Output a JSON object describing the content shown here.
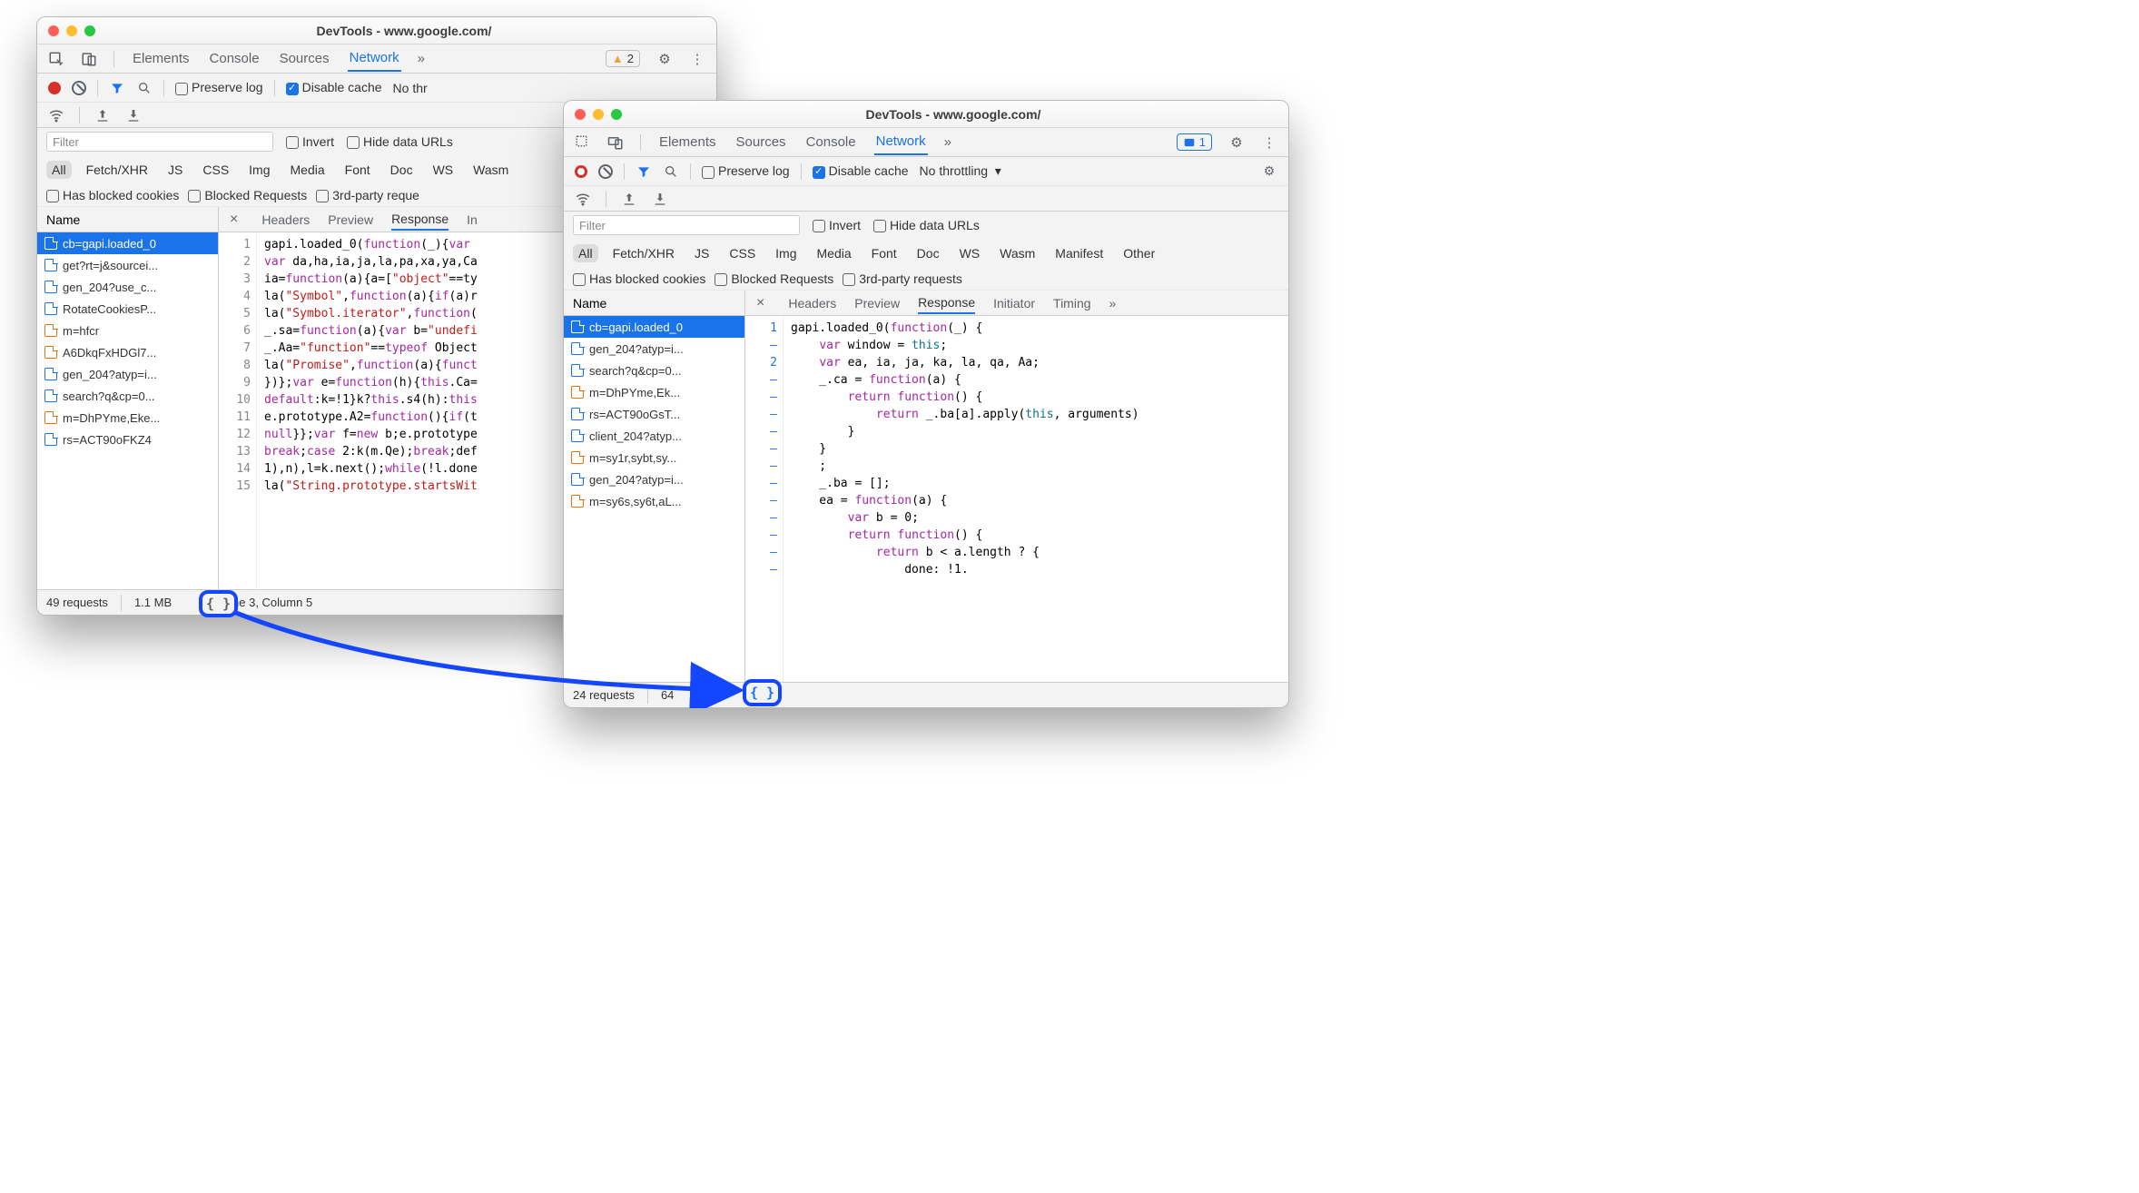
{
  "window1": {
    "title": "DevTools - www.google.com/",
    "tabs": [
      "Elements",
      "Console",
      "Sources",
      "Network"
    ],
    "active_tab": "Network",
    "more_tabs_icon": "»",
    "issues_count": "2",
    "preserve_log": "Preserve log",
    "disable_cache": "Disable cache",
    "throttling_truncated": "No thr",
    "filter_placeholder": "Filter",
    "invert": "Invert",
    "hide_data_urls": "Hide data URLs",
    "type_filters": [
      "All",
      "Fetch/XHR",
      "JS",
      "CSS",
      "Img",
      "Media",
      "Font",
      "Doc",
      "WS",
      "Wasm"
    ],
    "has_blocked_cookies": "Has blocked cookies",
    "blocked_requests": "Blocked Requests",
    "third_party_truncated": "3rd-party reque",
    "name_header": "Name",
    "requests": [
      {
        "name": "cb=gapi.loaded_0",
        "type": "js",
        "selected": true
      },
      {
        "name": "get?rt=j&sourcei...",
        "type": "doc"
      },
      {
        "name": "gen_204?use_c...",
        "type": "doc"
      },
      {
        "name": "RotateCookiesP...",
        "type": "txt"
      },
      {
        "name": "m=hfcr",
        "type": "js"
      },
      {
        "name": "A6DkqFxHDGl7...",
        "type": "js"
      },
      {
        "name": "gen_204?atyp=i...",
        "type": "doc"
      },
      {
        "name": "search?q&cp=0...",
        "type": "doc"
      },
      {
        "name": "m=DhPYme,Eke...",
        "type": "js"
      },
      {
        "name": "rs=ACT90oFKZ4",
        "type": "doc"
      }
    ],
    "detail_tabs": [
      "Headers",
      "Preview",
      "Response",
      "In"
    ],
    "detail_active": "Response",
    "gutter": " 1\n 2\n 3\n 4\n 5\n 6\n 7\n 8\n 9\n10\n11\n12\n13\n14\n15",
    "code_lines": [
      {
        "t": "gapi.loaded_0(",
        "kw": "function",
        "t2": "(_){",
        "kw2": "var",
        "t3": " "
      },
      {
        "kw": "var",
        "t": " da,ha,ia,ja,la,pa,xa,ya,Ca"
      },
      {
        "t": "ia=",
        "kw": "function",
        "t2": "(a){a=[",
        "str": "\"object\"",
        "t3": "==ty"
      },
      {
        "t": "la(",
        "str": "\"Symbol\"",
        "t2": ",",
        "kw": "function",
        "t3": "(a){",
        "kw2": "if",
        "t4": "(a)r"
      },
      {
        "t": "la(",
        "str": "\"Symbol.iterator\"",
        "t2": ",",
        "kw": "function",
        "t3": "("
      },
      {
        "t": "_.sa=",
        "kw": "function",
        "t2": "(a){",
        "kw2": "var",
        "t3": " b=",
        "str": "\"undefi"
      },
      {
        "t": "_.Aa=",
        "str": "\"function\"",
        "t2": "==",
        "kw": "typeof",
        "t3": " Object"
      },
      {
        "t": "la(",
        "str": "\"Promise\"",
        "t2": ",",
        "kw": "function",
        "t3": "(a){",
        "kw2": "funct"
      },
      {
        "t": "})};",
        "kw": "var",
        "t2": " e=",
        "kw2": "function",
        "t3": "(h){",
        "kw3": "this",
        "t4": ".Ca="
      },
      {
        "kw": "default",
        "t": ":k=!1}k?",
        "kw2": "this",
        "t2": ".s4(h):",
        "kw3": "this"
      },
      {
        "t": "e.prototype.A2=",
        "kw": "function",
        "t2": "(){",
        "kw2": "if",
        "t3": "(t"
      },
      {
        "kw": "null",
        "t": "}};",
        "kw2": "var",
        "t2": " f=",
        "kw3": "new",
        "t3": " b;e.prototype"
      },
      {
        "kw": "break",
        "t": ";",
        "kw2": "case",
        "t2": " 2:k(m.Qe);",
        "kw3": "break",
        "t3": ";def"
      },
      {
        "t": "1),n),l=k.next();",
        "kw": "while",
        "t2": "(!l.done"
      },
      {
        "t": "la(",
        "str": "\"String.prototype.startsWit"
      }
    ],
    "status_requests": "49 requests",
    "status_size": "1.1 MB",
    "status_cursor": "ine 3, Column 5",
    "pretty_print": "{ }"
  },
  "window2": {
    "title": "DevTools - www.google.com/",
    "tabs": [
      "Elements",
      "Sources",
      "Console",
      "Network"
    ],
    "active_tab": "Network",
    "more_tabs_icon": "»",
    "issues_count": "1",
    "preserve_log": "Preserve log",
    "disable_cache": "Disable cache",
    "throttling": "No throttling",
    "filter_placeholder": "Filter",
    "invert": "Invert",
    "hide_data_urls": "Hide data URLs",
    "type_filters": [
      "All",
      "Fetch/XHR",
      "JS",
      "CSS",
      "Img",
      "Media",
      "Font",
      "Doc",
      "WS",
      "Wasm",
      "Manifest",
      "Other"
    ],
    "has_blocked_cookies": "Has blocked cookies",
    "blocked_requests": "Blocked Requests",
    "third_party": "3rd-party requests",
    "name_header": "Name",
    "requests": [
      {
        "name": "cb=gapi.loaded_0",
        "type": "js",
        "selected": true
      },
      {
        "name": "gen_204?atyp=i...",
        "type": "doc"
      },
      {
        "name": "search?q&cp=0...",
        "type": "doc"
      },
      {
        "name": "m=DhPYme,Ek...",
        "type": "js"
      },
      {
        "name": "rs=ACT90oGsT...",
        "type": "doc"
      },
      {
        "name": "client_204?atyp...",
        "type": "doc"
      },
      {
        "name": "m=sy1r,sybt,sy...",
        "type": "js"
      },
      {
        "name": "gen_204?atyp=i...",
        "type": "doc"
      },
      {
        "name": "m=sy6s,sy6t,aL...",
        "type": "js"
      }
    ],
    "detail_tabs": [
      "Headers",
      "Preview",
      "Response",
      "Initiator",
      "Timing",
      "»"
    ],
    "detail_active": "Response",
    "gutter": "1\n–\n2\n–\n–\n–\n–\n–\n–\n–\n–\n–\n–\n–\n–",
    "code_lines": [
      {
        "t": "gapi.loaded_0(",
        "kw": "function",
        "t2": "(_) {"
      },
      {
        "pad": "    ",
        "kw": "var",
        "t": " window = ",
        "th": "this",
        "t2": ";"
      },
      {
        "pad": "    ",
        "kw": "var",
        "t": " ea, ia, ja, ka, la, qa, Aa;"
      },
      {
        "pad": "    ",
        "t": "_.ca = ",
        "kw": "function",
        "t2": "(a) {"
      },
      {
        "pad": "        ",
        "kw": "return",
        "t": " ",
        "kw2": "function",
        "t2": "() {"
      },
      {
        "pad": "            ",
        "kw": "return",
        "t": " _.ba[a].apply(",
        "th": "this",
        "t2": ", arguments)"
      },
      {
        "pad": "        ",
        "t": "}"
      },
      {
        "pad": "    ",
        "t": "}"
      },
      {
        "pad": "    ",
        "t": ";"
      },
      {
        "pad": "    ",
        "t": "_.ba = [];"
      },
      {
        "pad": "    ",
        "t": "ea = ",
        "kw": "function",
        "t2": "(a) {"
      },
      {
        "pad": "        ",
        "kw": "var",
        "t": " b = 0;"
      },
      {
        "pad": "        ",
        "kw": "return",
        "t": " ",
        "kw2": "function",
        "t2": "() {"
      },
      {
        "pad": "            ",
        "kw": "return",
        "t": " b < a.length ? {"
      },
      {
        "pad": "                ",
        "t": "done: !1."
      }
    ],
    "status_requests": "24 requests",
    "status_size": "64",
    "pretty_print": "{ }"
  }
}
